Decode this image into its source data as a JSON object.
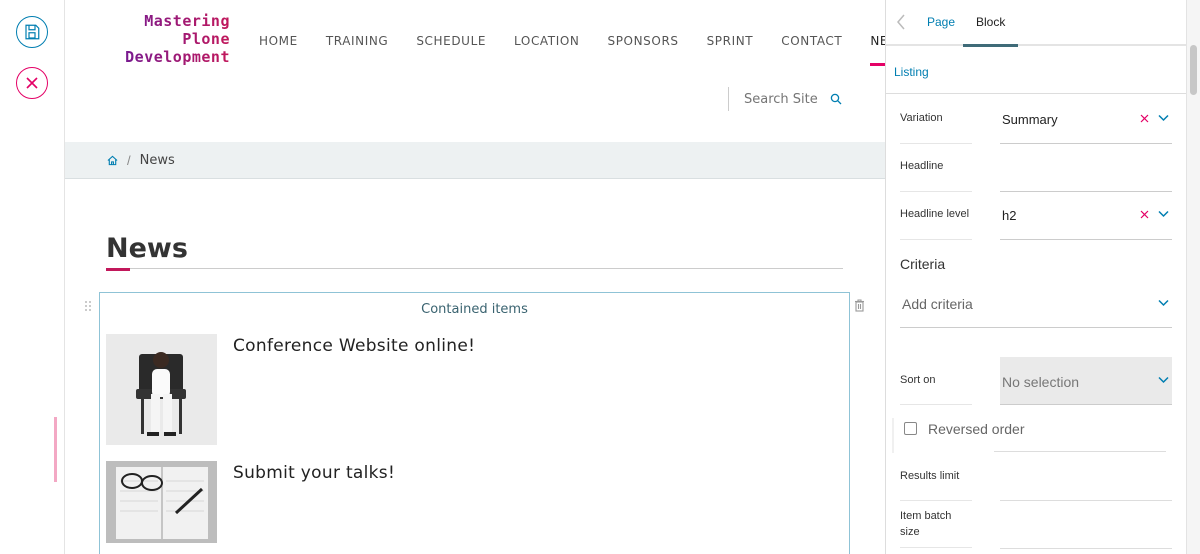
{
  "toolbar": {
    "save_icon": "floppy-disk-icon",
    "cancel_icon": "circle-x-icon",
    "colors": {
      "save": "#007eb1",
      "cancel": "#e40166"
    }
  },
  "site": {
    "logo": {
      "line1": "Mastering",
      "line2": "Plone",
      "line3": "Development"
    },
    "nav": [
      "HOME",
      "TRAINING",
      "SCHEDULE",
      "LOCATION",
      "SPONSORS",
      "SPRINT",
      "CONTACT",
      "NEWS"
    ],
    "search": {
      "placeholder": "Search Site"
    },
    "breadcrumb": {
      "current": "News"
    },
    "page_title": "News",
    "listing": {
      "header": "Contained items",
      "items": [
        {
          "title": "Conference Website online!"
        },
        {
          "title": "Submit your talks!"
        }
      ]
    },
    "accent": "#e40166"
  },
  "sidebar": {
    "tabs": {
      "page": "Page",
      "block": "Block"
    },
    "section": "Listing",
    "fields": {
      "variation": {
        "label": "Variation",
        "value": "Summary"
      },
      "headline": {
        "label": "Headline",
        "value": ""
      },
      "headline_level": {
        "label": "Headline level",
        "value": "h2"
      },
      "criteria": {
        "heading": "Criteria",
        "placeholder": "Add criteria"
      },
      "sort_on": {
        "label": "Sort on",
        "value": "No selection"
      },
      "reversed": {
        "label": "Reversed order"
      },
      "results_limit": {
        "label": "Results limit"
      },
      "batch_line1": {
        "label": "Item batch"
      },
      "batch_line2": {
        "label": "size"
      }
    }
  }
}
